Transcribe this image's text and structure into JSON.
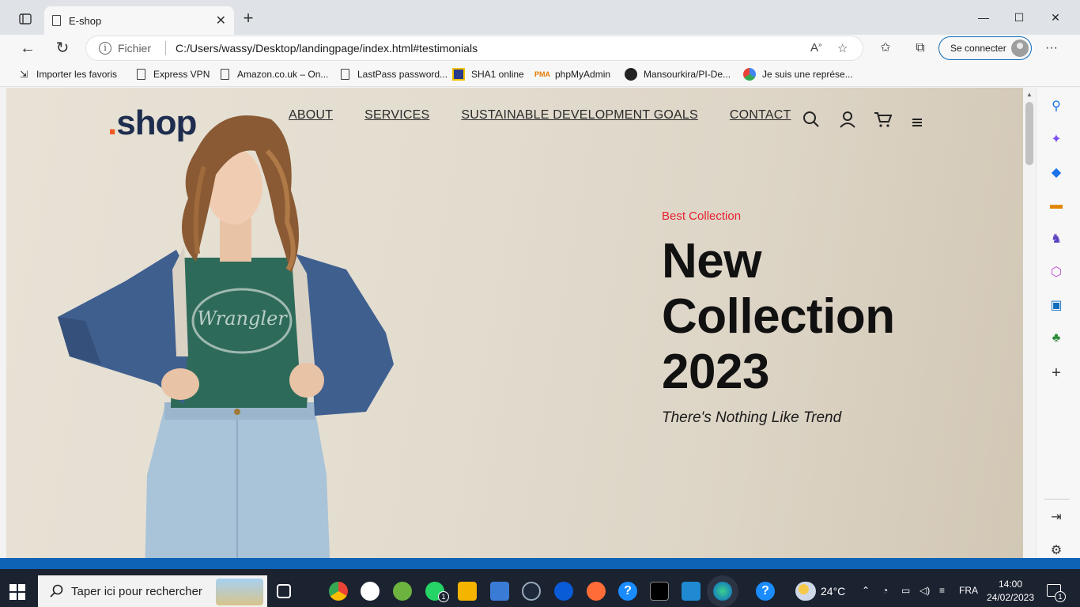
{
  "browser": {
    "tab_title": "E-shop",
    "address_prefix": "Fichier",
    "url": "C:/Users/wassy/Desktop/landingpage/index.html#testimonials",
    "signin_label": "Se connecter",
    "favorites": [
      {
        "label": "Importer les favoris",
        "icon": "import-icon"
      },
      {
        "label": "Express VPN",
        "icon": "page-icon"
      },
      {
        "label": "Amazon.co.uk – On...",
        "icon": "page-icon"
      },
      {
        "label": "LastPass password...",
        "icon": "page-icon"
      },
      {
        "label": "SHA1 online",
        "icon": "sha1-icon"
      },
      {
        "label": "phpMyAdmin",
        "icon": "phpmyadmin-icon"
      },
      {
        "label": "Mansourkira/PI-De...",
        "icon": "github-icon"
      },
      {
        "label": "Je suis une représe...",
        "icon": "chrome-icon"
      }
    ]
  },
  "site": {
    "logo_dot": ".",
    "logo_text": "shop",
    "menu": [
      "ABOUT",
      "SERVICES",
      "SUSTAINABLE DEVELOPMENT GOALS",
      "CONTACT"
    ],
    "hero": {
      "kicker": "Best Collection",
      "title_line1": "New",
      "title_line2": "Collection",
      "title_line3": "2023",
      "tagline": "There's Nothing Like Trend"
    },
    "colors": {
      "accent": "#e5212f",
      "logo_dot": "#ef5a24",
      "logo": "#1e2d4f"
    }
  },
  "taskbar": {
    "search_placeholder": "Taper ici pour rechercher",
    "weather": "24°C",
    "language": "FRA",
    "time": "14:00",
    "date": "24/02/2023",
    "notification_count": "1",
    "whatsapp_badge": "1"
  }
}
